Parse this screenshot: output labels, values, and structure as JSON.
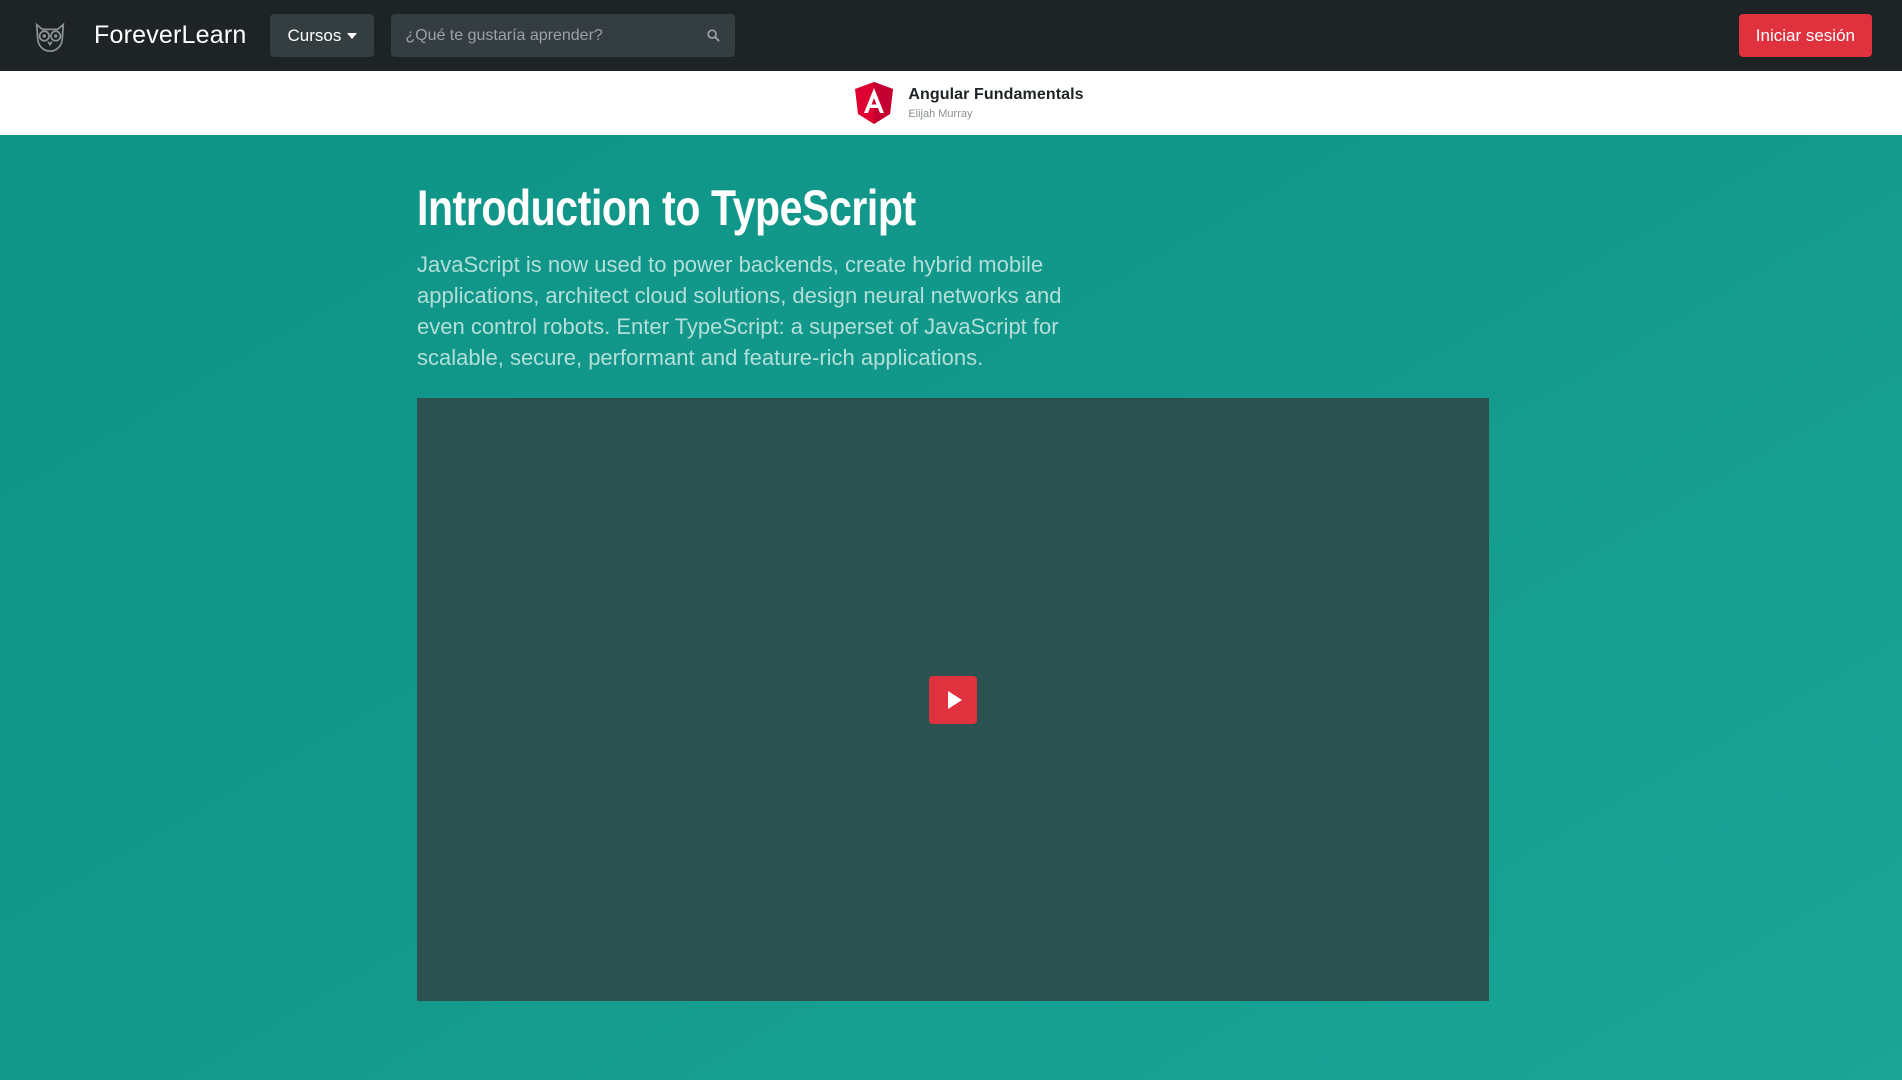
{
  "navbar": {
    "logo_icon": "owl-logo-icon",
    "brand_name": "ForeverLearn",
    "courses_label": "Cursos",
    "search": {
      "placeholder": "¿Qué te gustaría aprender?",
      "value": "",
      "icon": "search-icon"
    },
    "login_label": "Iniciar sesión"
  },
  "course": {
    "logo_icon": "angular-logo-icon",
    "title": "Angular Fundamentals",
    "author": "Elijah Murray"
  },
  "lesson": {
    "title": "Introduction to TypeScript",
    "description": "JavaScript is now used to power backends, create hybrid mobile applications, architect cloud solutions, design neural networks and even control robots. Enter TypeScript: a superset of JavaScript for scalable, secure, performant and feature-rich applications."
  },
  "video": {
    "play_icon": "play-icon"
  },
  "colors": {
    "navbar_bg": "#1e2326",
    "accent_red": "#e0323e",
    "hero_bg": "#13998c",
    "video_bg": "#2c5151",
    "angular_red": "#dd0031"
  }
}
